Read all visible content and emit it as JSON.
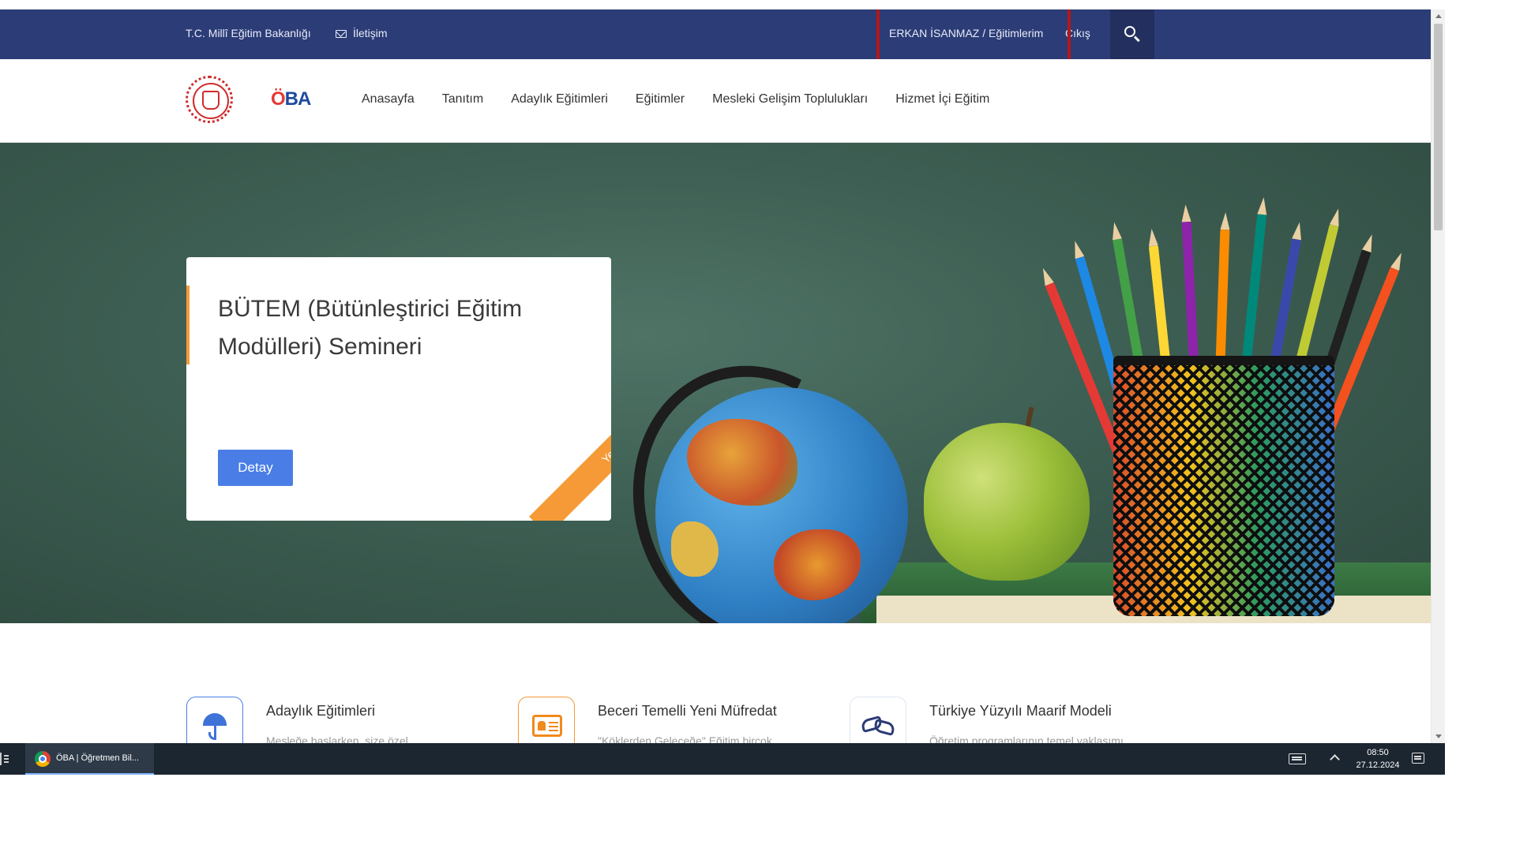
{
  "topbar": {
    "ministry_link": "T.C. Millî Eğitim Bakanlığı",
    "contact_link": "İletişim",
    "user_link": "ERKAN İSANMAZ / Eğitimlerim",
    "logout_link": "Çıkış"
  },
  "nav": {
    "logo_text_o": "Ö",
    "logo_text_rest": "BA",
    "items": [
      "Anasayfa",
      "Tanıtım",
      "Adaylık Eğitimleri",
      "Eğitimler",
      "Mesleki Gelişim Toplulukları",
      "Hizmet İçi Eğitim"
    ]
  },
  "hero": {
    "card_title": "BÜTEM (Bütünleştirici Eğitim Modülleri) Semineri",
    "detail_button": "Detay",
    "ribbon": "Yeni"
  },
  "features": [
    {
      "title": "Adaylık Eğitimleri",
      "desc": "Mesleğe başlarken, size özel",
      "icon": "umbrella-icon"
    },
    {
      "title": "Beceri Temelli Yeni Müfredat",
      "desc": "\"Köklerden Geleceğe\" Eğitim birçok",
      "icon": "id-card-icon"
    },
    {
      "title": "Türkiye Yüzyılı Maarif Modeli",
      "desc": "Öğretim programlarının temel yaklaşımı,",
      "icon": "handshake-icon"
    }
  ],
  "taskbar": {
    "app_label": "ÖBA | Öğretmen Bil...",
    "time": "08:50",
    "date": "27.12.2024"
  },
  "colors": {
    "topbar": "#2c3c77",
    "accent_blue": "#4a7ee6",
    "accent_orange": "#f59a36",
    "highlight_red": "#b3171b"
  }
}
